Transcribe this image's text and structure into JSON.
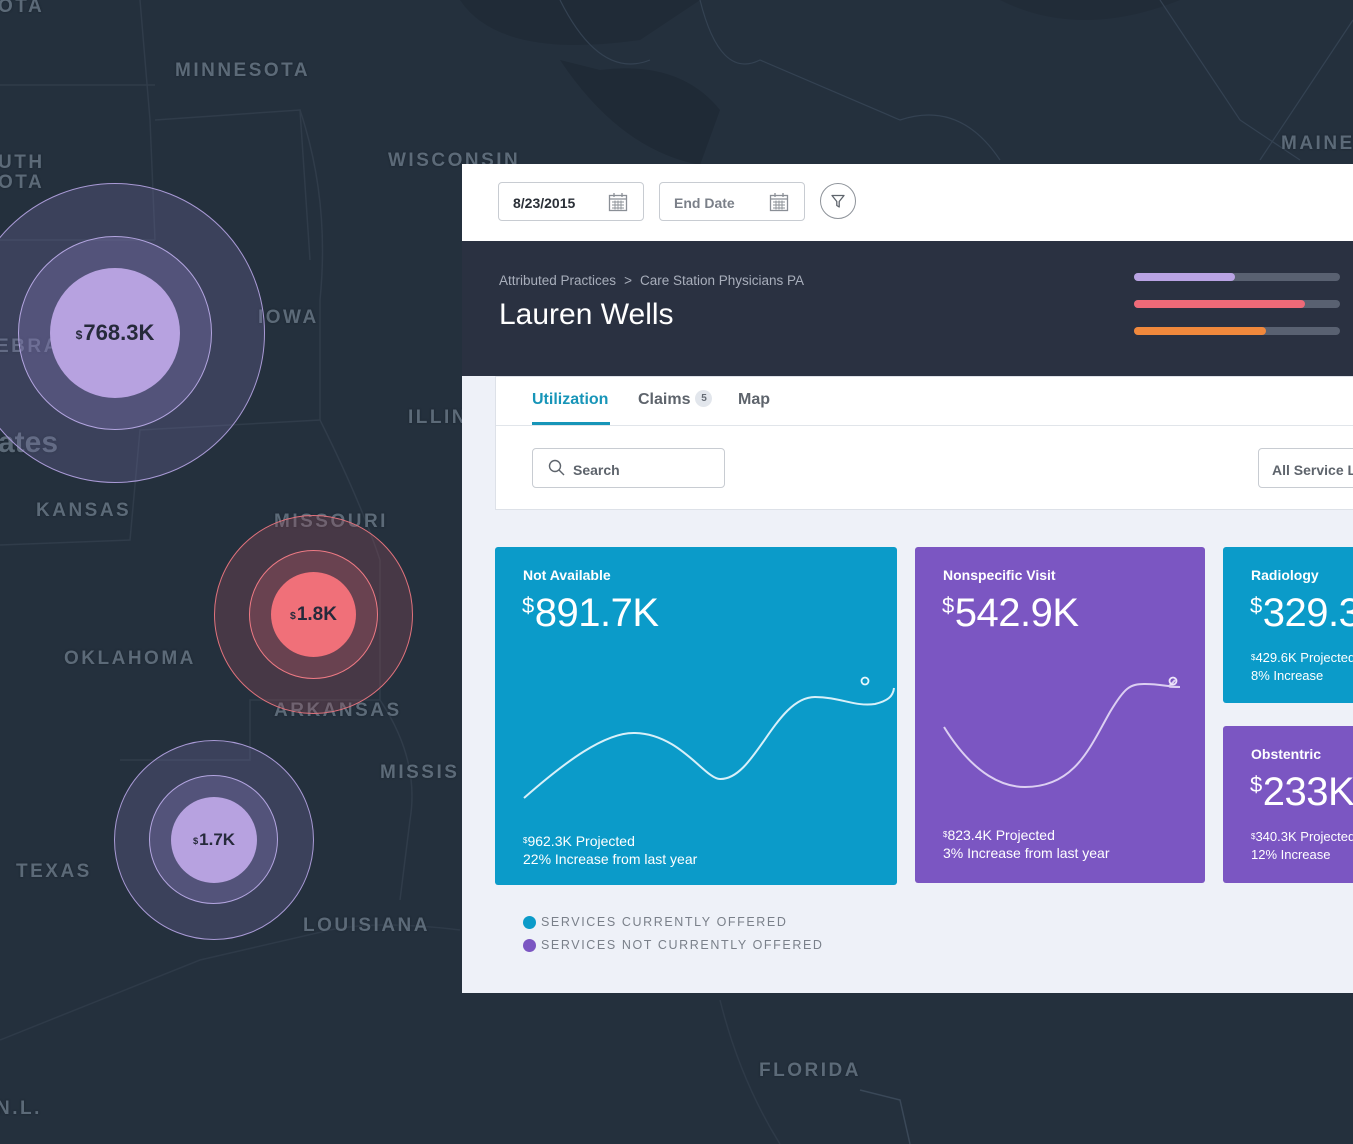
{
  "map": {
    "states": [
      {
        "id": "state-north-dakota",
        "label": "OTA"
      },
      {
        "id": "state-minnesota",
        "label": "MINNESOTA"
      },
      {
        "id": "state-south-dakota-1",
        "label": "UTH"
      },
      {
        "id": "state-south-dakota-2",
        "label": "OTA"
      },
      {
        "id": "state-wisconsin",
        "label": "WISCONSIN"
      },
      {
        "id": "state-maine",
        "label": "MAINE"
      },
      {
        "id": "state-iowa",
        "label": "IOWA"
      },
      {
        "id": "state-nebraska",
        "label": "EBRA"
      },
      {
        "id": "state-united-states",
        "label": "ates"
      },
      {
        "id": "state-illinois",
        "label": "ILLIN"
      },
      {
        "id": "state-kansas",
        "label": "KANSAS"
      },
      {
        "id": "state-missouri",
        "label": "MISSOURI"
      },
      {
        "id": "state-oklahoma",
        "label": "OKLAHOMA"
      },
      {
        "id": "state-arkansas",
        "label": "ARKANSAS"
      },
      {
        "id": "state-mississippi",
        "label": "MISSIS"
      },
      {
        "id": "state-texas",
        "label": "TEXAS"
      },
      {
        "id": "state-louisiana",
        "label": "LOUISIANA"
      },
      {
        "id": "state-florida",
        "label": "FLORIDA"
      },
      {
        "id": "state-nl",
        "label": "N.L."
      }
    ],
    "bubbles": [
      {
        "currency": "$",
        "amount": "768.3K",
        "color": "#b7a2e0"
      },
      {
        "currency": "$",
        "amount": "1.8K",
        "color": "#f07079"
      },
      {
        "currency": "$",
        "amount": "1.7K",
        "color": "#b7a2e0"
      }
    ]
  },
  "toolbar": {
    "start_date": "8/23/2015",
    "end_date_placeholder": "End Date"
  },
  "header": {
    "breadcrumb": [
      "Attributed Practices",
      ">",
      "Care Station Physicians PA"
    ],
    "name": "Lauren Wells",
    "progress_bars": [
      {
        "value": 0.49,
        "color": "#b9a3e3"
      },
      {
        "value": 0.83,
        "color": "#ee6a78"
      },
      {
        "value": 0.64,
        "color": "#f0883c"
      }
    ]
  },
  "tabs": [
    {
      "label": "Utilization",
      "active": true
    },
    {
      "label": "Claims",
      "badge": "5"
    },
    {
      "label": "Map"
    }
  ],
  "filters": {
    "search_placeholder": "Search",
    "service_select": "All Service L"
  },
  "cards": [
    {
      "title": "Not Available",
      "currency": "$",
      "value": "891.7K",
      "proj_currency": "$",
      "projected": "962.3K Projected",
      "increase": "22% Increase from last year",
      "color": "#0b9bc9"
    },
    {
      "title": "Nonspecific Visit",
      "currency": "$",
      "value": "542.9K",
      "proj_currency": "$",
      "projected": "823.4K Projected",
      "increase": "3% Increase from last year",
      "color": "#7b56c2"
    },
    {
      "title": "Radiology",
      "currency": "$",
      "value": "329.3",
      "proj_currency": "$",
      "projected": "429.6K Projected",
      "increase": "8% Increase",
      "color": "#0b9bc9"
    },
    {
      "title": "Obstentric",
      "currency": "$",
      "value": "233K",
      "proj_currency": "$",
      "projected": "340.3K Projected",
      "increase": "12% Increase",
      "color": "#7b56c2"
    }
  ],
  "legend": [
    {
      "label": "SERVICES CURRENTLY OFFERED",
      "color": "#0b9bc9"
    },
    {
      "label": "SERVICES NOT CURRENTLY OFFERED",
      "color": "#7b56c2"
    }
  ]
}
